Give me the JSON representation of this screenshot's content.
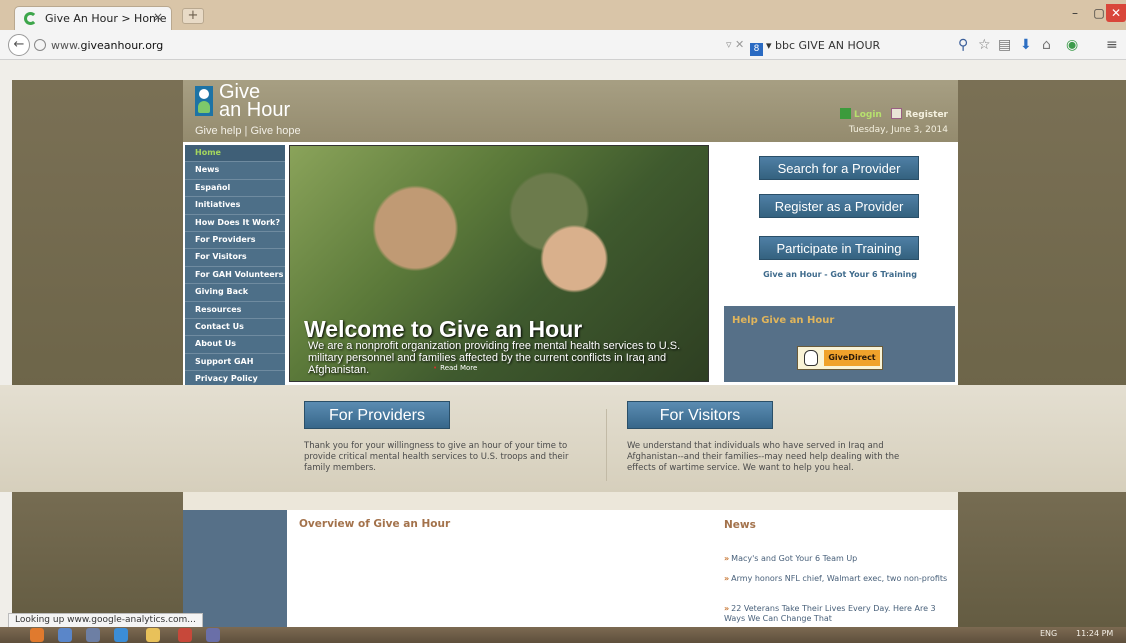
{
  "browser": {
    "tab_title": "Give An Hour > Home",
    "tab_close": "×",
    "new_tab": "+",
    "win_min": "–",
    "win_max": "▢",
    "win_close": "✕",
    "back": "←",
    "url_plain": "www.",
    "url_host": "giveanhour.org",
    "omni_controls": "▿ ✕",
    "search_engine_badge": "8",
    "search_query": "▾ bbc GIVE AN HOUR",
    "icons": {
      "search": "⚲",
      "star": "☆",
      "clipboard": "▤",
      "download": "⬇",
      "home": "⌂",
      "extension": "◉",
      "menu": "≡"
    },
    "status_text": "Looking up www.google-analytics.com..."
  },
  "header": {
    "logo_line1": "Give",
    "logo_line2": "an Hour",
    "tagline": "Give help | Give hope",
    "login": "Login",
    "register": "Register",
    "date": "Tuesday, June 3, 2014"
  },
  "nav": {
    "items": [
      "Home",
      "News",
      "Español",
      "Initiatives",
      "How Does It Work?",
      "For Providers",
      "For Visitors",
      "For GAH Volunteers",
      "Giving Back",
      "Resources",
      "Contact Us",
      "About Us",
      "Support GAH",
      "Privacy Policy"
    ]
  },
  "hero": {
    "title": "Welcome to Give an Hour",
    "text": "We are a nonprofit organization providing free mental health services to U.S. military personnel and families affected by the current conflicts in Iraq and Afghanistan.",
    "read_more": "Read More"
  },
  "cta": {
    "search": "Search for a Provider",
    "register": "Register as a Provider",
    "training": "Participate in Training",
    "training_link": "Give an Hour - Got Your 6 Training"
  },
  "help": {
    "title": "Help Give an Hour",
    "give_direct": "GiveDirect"
  },
  "providers": {
    "button": "For Providers",
    "text": "Thank you for your willingness to give an hour of your time to provide critical mental health services to U.S. troops and their family members."
  },
  "visitors": {
    "button": "For Visitors",
    "text": "We understand that individuals who have served in Iraq and Afghanistan--and their families--may need help dealing with the effects of wartime service. We want to help you heal."
  },
  "overview": {
    "title": "Overview of Give an Hour"
  },
  "news": {
    "title": "News",
    "bullet": "»",
    "items": [
      "Macy's and Got Your 6 Team Up",
      "Army honors NFL chief, Walmart exec, two non-profits",
      "22 Veterans Take Their Lives Every Day. Here Are 3 Ways We Can Change That"
    ]
  },
  "taskbar": {
    "language": "ENG",
    "time": "11:24 PM"
  },
  "colors": {
    "nav_bg": "#4d6f88",
    "nav_active_text": "#a4d65e",
    "cta_blue": "#3f6f93",
    "accent_brown": "#a3724b",
    "header_olive": "#9f977a"
  }
}
